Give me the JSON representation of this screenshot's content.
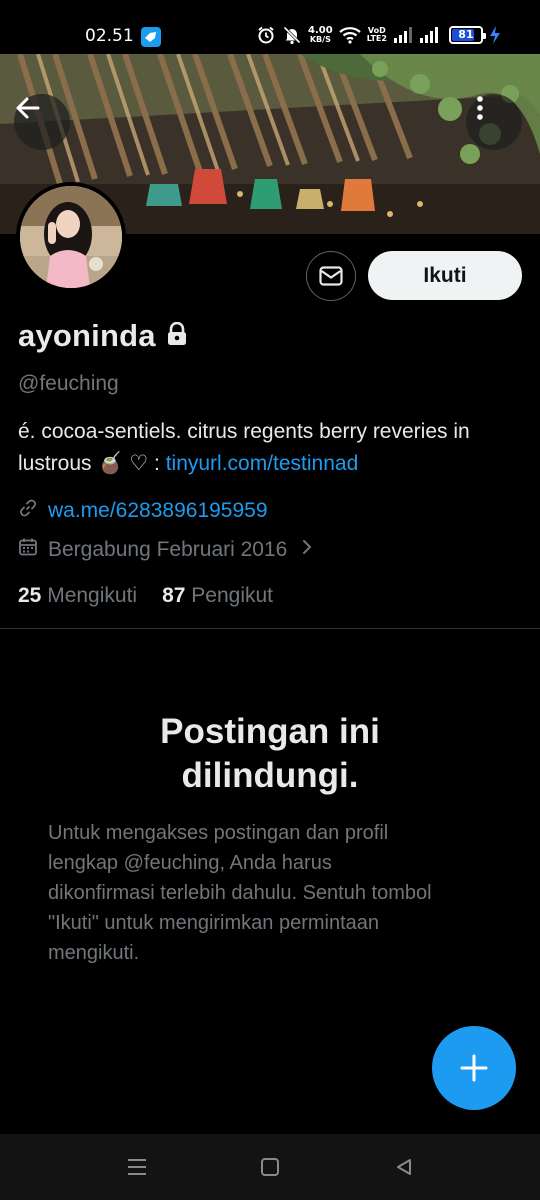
{
  "status_bar": {
    "time": "02.51",
    "net_speed_value": "4.00",
    "net_speed_unit": "KB/S",
    "volte_top": "VoD",
    "volte_bottom": "LTE2",
    "battery_level": "81",
    "battery_fraction": 0.81
  },
  "profile": {
    "display_name": "ayoninda",
    "handle": "@feuching",
    "bio_text": "é. cocoa-sentiels. citrus regents berry reveries in lustrous 🧉 ♡ : ",
    "bio_link": "tinyurl.com/testinnad",
    "website": "wa.me/6283896195959",
    "joined": "Bergabung Februari 2016",
    "following_count": "25",
    "following_label": "Mengikuti",
    "followers_count": "87",
    "followers_label": "Pengikut"
  },
  "actions": {
    "follow_label": "Ikuti"
  },
  "protected": {
    "title": "Postingan ini dilindungi.",
    "description": "Untuk mengakses postingan dan profil lengkap @feuching, Anda harus dikonfirmasi terlebih dahulu. Sentuh tombol \"Ikuti\" untuk mengirimkan permintaan mengikuti."
  },
  "colors": {
    "background": "#000000",
    "accent": "#1d9bf0",
    "text_primary": "#e7e9ea",
    "text_secondary": "#71767b",
    "battery_fill": "#1d4ed8"
  },
  "icons": {
    "back": "arrow-left-icon",
    "more": "more-vertical-icon",
    "lock": "lock-icon",
    "link": "link-icon",
    "calendar": "calendar-icon",
    "chevron": "chevron-right-icon",
    "message": "envelope-icon",
    "compose": "plus-icon"
  }
}
